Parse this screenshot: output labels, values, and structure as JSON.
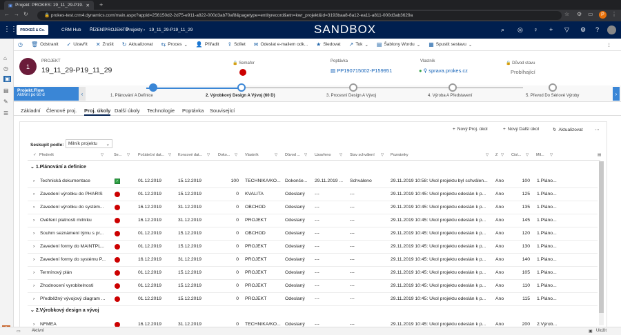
{
  "browser": {
    "tab_title": "Projekt: PROKES: 19_11_29-P19...",
    "url": "prokes-test.crm4.dynamics.com/main.aspx?appid=256150d2-2d75-e911-a822-000d3ab70af8&pagetype=entityrecord&etn=kwr_projekt&id=3193baa8-8a12-ea11-a811-000d3ab3629a",
    "avatar_letter": "P"
  },
  "header": {
    "logo_text": "PROKEŠ & Co.",
    "app_name": "CRM Hub",
    "breadcrumb": [
      "ŘÍZENÍPROJEKTŮ",
      "Projekty",
      "19_11_29-P19_11_29"
    ],
    "environment": "SANDBOX"
  },
  "commands": [
    {
      "icon": "delete-icon",
      "glyph": "🗑",
      "label": "Odstranit"
    },
    {
      "icon": "check-icon",
      "glyph": "✓",
      "label": "Uzavřít"
    },
    {
      "icon": "close-icon",
      "glyph": "✕",
      "label": "Zrušit"
    },
    {
      "icon": "refresh-icon",
      "glyph": "↻",
      "label": "Aktualizovat"
    },
    {
      "icon": "process-icon",
      "glyph": "⇆",
      "label": "Proces",
      "dropdown": true
    },
    {
      "icon": "assign-icon",
      "glyph": "👤",
      "label": "Přiřadit"
    },
    {
      "icon": "share-icon",
      "glyph": "⇪",
      "label": "Sdílet"
    },
    {
      "icon": "email-link-icon",
      "glyph": "✉",
      "label": "Odeslat e-mailem odk..."
    },
    {
      "icon": "follow-icon",
      "glyph": "★",
      "label": "Sledovat"
    },
    {
      "icon": "flow-icon",
      "glyph": "↗",
      "label": "Tok",
      "dropdown": true
    },
    {
      "icon": "word-template-icon",
      "glyph": "▤",
      "label": "Šablony Wordu",
      "dropdown": true
    },
    {
      "icon": "report-icon",
      "glyph": "▦",
      "label": "Spustit sestavu",
      "dropdown": true
    }
  ],
  "record": {
    "avatar": "1",
    "type": "PROJEKT",
    "name": "19_11_29-P19_11_29",
    "semafor_label": "Semafor",
    "poptavka_label": "Poptávka",
    "poptavka_value": "PP190715002-P159951",
    "vlastnik_label": "Vlastník",
    "vlastnik_value": "sprava.prokes.cz",
    "duvod_label": "Důvod stavu",
    "duvod_value": "Probíhající"
  },
  "bpf": {
    "flow_name": "Projekt.Flow",
    "flow_status": "Aktivní po 60 d",
    "stages": [
      {
        "label": "1. Plánování A Definice",
        "state": "done"
      },
      {
        "label": "2. Výrobkový Design A Vývoj  (60 D)",
        "state": "active"
      },
      {
        "label": "3. Procesní Design A Vývoj",
        "state": "todo"
      },
      {
        "label": "4. Výroba A Představení",
        "state": "todo"
      },
      {
        "label": "5. Převod Do Sériové Výroby",
        "state": "todo"
      }
    ]
  },
  "tabs": [
    "Základní",
    "Členové proj.",
    "Proj. úkoly",
    "Další úkoly",
    "Technologie",
    "Poptávka",
    "Související"
  ],
  "grid": {
    "commands": [
      "Nový Proj. úkol",
      "Nový Další úkol",
      "Aktualizovat"
    ],
    "groupby_label": "Seskupit podle:",
    "groupby_value": "Milník projektu",
    "columns": [
      "Předmět",
      "Se...",
      "Počáteční dat...",
      "Koncové dat...",
      "Doko...",
      "Vlastník",
      "Důvod ...",
      "Uzavřeno",
      "Stav schválení",
      "Poznámky",
      "Z",
      "Čísl...",
      "Mil..."
    ],
    "groups": [
      {
        "name": "1.Plánování a definice",
        "rows": [
          {
            "subject": "Technická dokumentace",
            "sem": "green",
            "start": "01.12.2019",
            "end": "15.12.2019",
            "done": "100",
            "owner": "TECHNIKA/KO...",
            "reason": "Dokonče...",
            "closed": "29.11.2019 ...",
            "approval": "Schváleno",
            "notes": "29.11.2019 10:58: Úkol projektu byl schválen...",
            "z": "Ano",
            "num": "100",
            "mil": "1.Pláno..."
          },
          {
            "subject": "Zavedení výrobku do PHARIS",
            "sem": "red",
            "start": "01.12.2019",
            "end": "15.12.2019",
            "done": "0",
            "owner": "KVALITA",
            "reason": "Odeslaný",
            "closed": "---",
            "approval": "---",
            "notes": "29.11.2019 10:45: Úkol projektu odeslán k p...",
            "z": "Ano",
            "num": "125",
            "mil": "1.Pláno..."
          },
          {
            "subject": "Zavedení výrobku do systém...",
            "sem": "red",
            "start": "16.12.2019",
            "end": "31.12.2019",
            "done": "0",
            "owner": "OBCHOD",
            "reason": "Odeslaný",
            "closed": "---",
            "approval": "---",
            "notes": "29.11.2019 10:45: Úkol projektu odeslán k p...",
            "z": "Ano",
            "num": "135",
            "mil": "1.Pláno..."
          },
          {
            "subject": "Ověření platnosti milníku",
            "sem": "red",
            "start": "16.12.2019",
            "end": "31.12.2019",
            "done": "0",
            "owner": "PROJEKT",
            "reason": "Odeslaný",
            "closed": "---",
            "approval": "---",
            "notes": "29.11.2019 10:45: Úkol projektu odeslán k p...",
            "z": "Ano",
            "num": "145",
            "mil": "1.Pláno..."
          },
          {
            "subject": "Souhrn seznámení týmu s pr...",
            "sem": "red",
            "start": "01.12.2019",
            "end": "15.12.2019",
            "done": "0",
            "owner": "OBCHOD",
            "reason": "Odeslaný",
            "closed": "---",
            "approval": "---",
            "notes": "29.11.2019 10:45: Úkol projektu odeslán k p...",
            "z": "Ano",
            "num": "120",
            "mil": "1.Pláno..."
          },
          {
            "subject": "Zavedení formy do MAINTPL...",
            "sem": "red",
            "start": "01.12.2019",
            "end": "15.12.2019",
            "done": "0",
            "owner": "PROJEKT",
            "reason": "Odeslaný",
            "closed": "---",
            "approval": "---",
            "notes": "29.11.2019 10:45: Úkol projektu odeslán k p...",
            "z": "Ano",
            "num": "130",
            "mil": "1.Pláno..."
          },
          {
            "subject": "Zavedení formy do systému P...",
            "sem": "red",
            "start": "16.12.2019",
            "end": "31.12.2019",
            "done": "0",
            "owner": "PROJEKT",
            "reason": "Odeslaný",
            "closed": "---",
            "approval": "---",
            "notes": "29.11.2019 10:45: Úkol projektu odeslán k p...",
            "z": "Ano",
            "num": "140",
            "mil": "1.Pláno..."
          },
          {
            "subject": "Termínový plán",
            "sem": "red",
            "start": "01.12.2019",
            "end": "15.12.2019",
            "done": "0",
            "owner": "PROJEKT",
            "reason": "Odeslaný",
            "closed": "---",
            "approval": "---",
            "notes": "29.11.2019 10:45: Úkol projektu odeslán k p...",
            "z": "Ano",
            "num": "105",
            "mil": "1.Pláno..."
          },
          {
            "subject": "Zhodnocení vyrobitelnosti",
            "sem": "red",
            "start": "01.12.2019",
            "end": "15.12.2019",
            "done": "0",
            "owner": "PROJEKT",
            "reason": "Odeslaný",
            "closed": "---",
            "approval": "---",
            "notes": "29.11.2019 10:45: Úkol projektu odeslán k p...",
            "z": "Ano",
            "num": "110",
            "mil": "1.Pláno..."
          },
          {
            "subject": "Předběžný vývojový diagram ...",
            "sem": "red",
            "start": "01.12.2019",
            "end": "15.12.2019",
            "done": "0",
            "owner": "PROJEKT",
            "reason": "Odeslaný",
            "closed": "---",
            "approval": "---",
            "notes": "29.11.2019 10:45: Úkol projektu odeslán k p...",
            "z": "Ano",
            "num": "115",
            "mil": "1.Pláno..."
          }
        ]
      },
      {
        "name": "2.Výrobkový design a vývoj",
        "rows": [
          {
            "subject": "NFMEA",
            "sem": "red",
            "start": "16.12.2019",
            "end": "31.12.2019",
            "done": "0",
            "owner": "TECHNIKA/KO...",
            "reason": "Odeslaný",
            "closed": "---",
            "approval": "---",
            "notes": "29.11.2019 10:45: Úkol projektu odeslán k p...",
            "z": "Ano",
            "num": "200",
            "mil": "2.Výrob..."
          }
        ]
      }
    ]
  },
  "status": {
    "left": "Aktivní",
    "right": "Uložit"
  }
}
